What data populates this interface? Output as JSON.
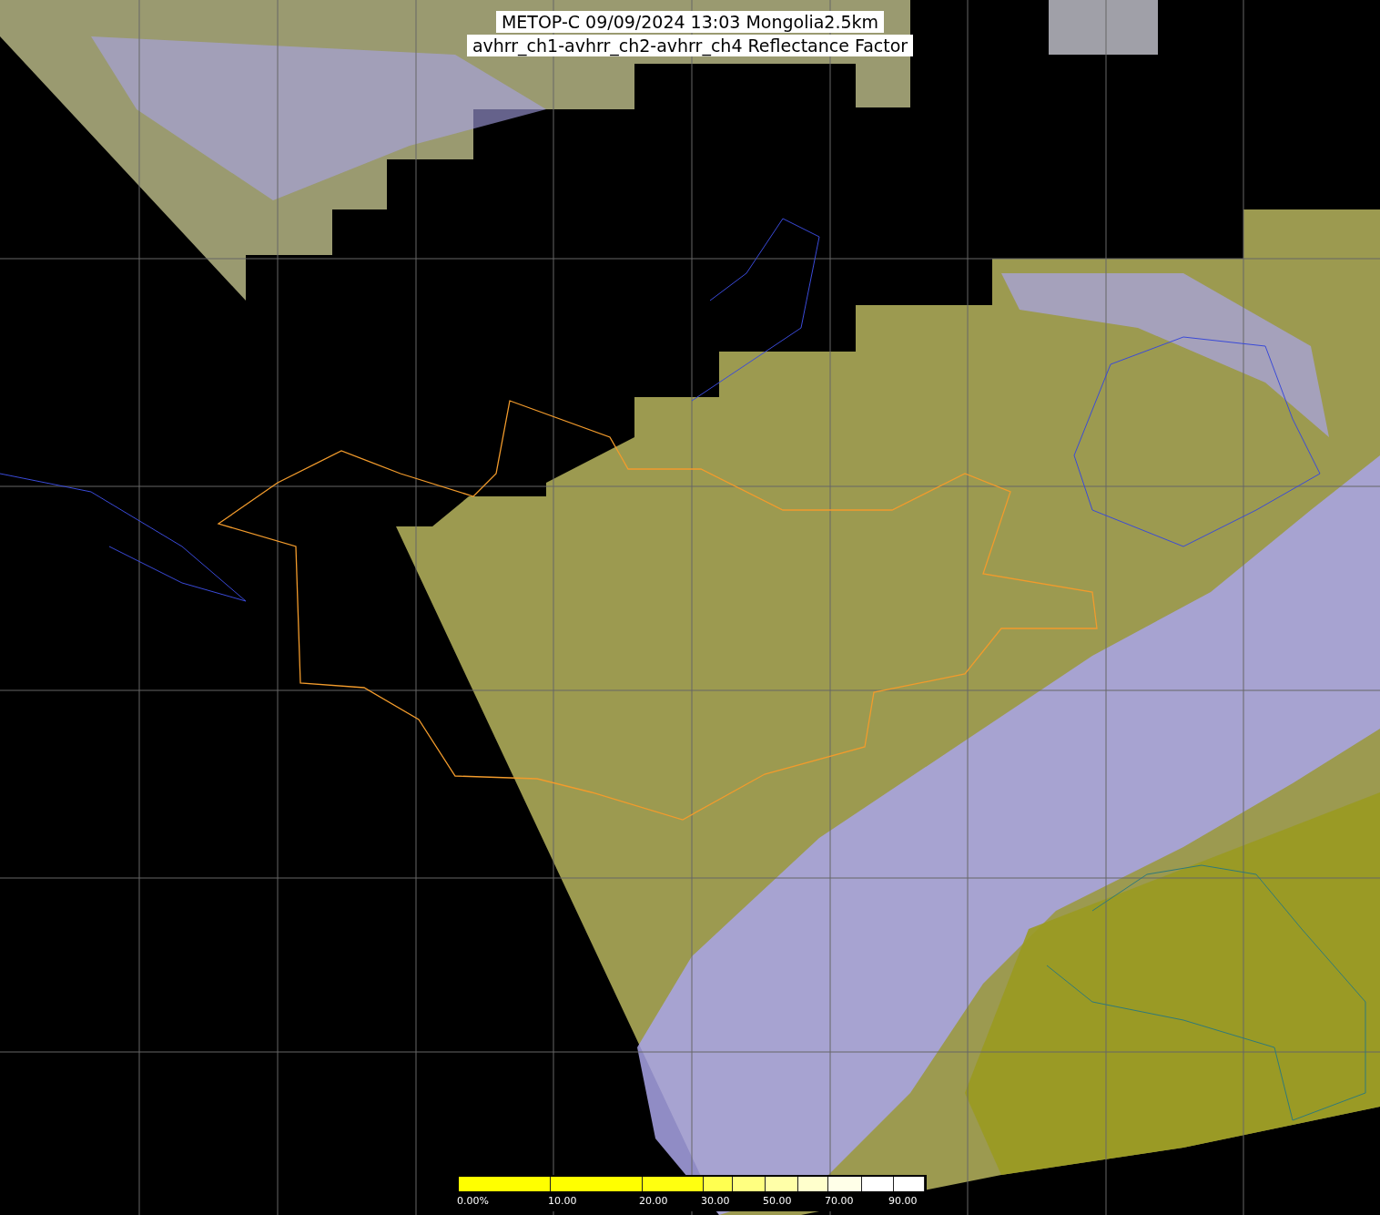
{
  "title": {
    "lines": [
      "METOP-C 09/09/2024 13:03 Mongolia2.5km",
      "avhrr_ch1-avhrr_ch2-avhrr_ch4 Reflectance Factor"
    ]
  },
  "colorbar": {
    "segments": [
      {
        "color": "#ffff00"
      },
      {
        "color": "#ffff00"
      },
      {
        "color": "#ffff10"
      },
      {
        "color": "#ffff50"
      },
      {
        "color": "#ffff80"
      },
      {
        "color": "#ffffa8"
      },
      {
        "color": "#ffffcc"
      },
      {
        "color": "#ffffe8"
      },
      {
        "color": "#ffffff"
      },
      {
        "color": "#ffffff"
      }
    ],
    "labels": [
      "0.00%",
      "10.00",
      "20.00",
      "30.00",
      "50.00",
      "70.00",
      "90.00"
    ]
  }
}
